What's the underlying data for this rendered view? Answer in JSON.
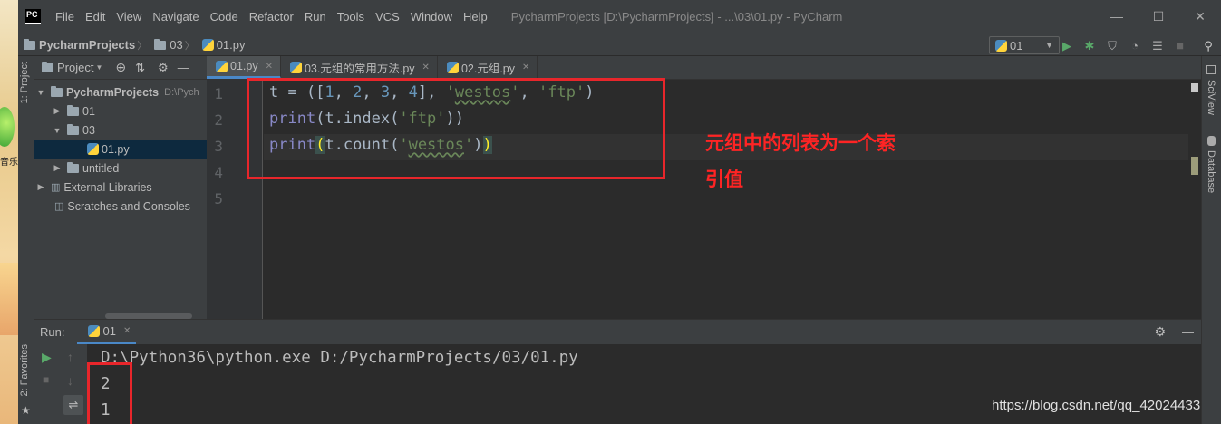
{
  "desktop": {
    "shortcut_label": "音乐"
  },
  "titlebar": {
    "logo": "PC",
    "menu": [
      "File",
      "Edit",
      "View",
      "Navigate",
      "Code",
      "Refactor",
      "Run",
      "Tools",
      "VCS",
      "Window",
      "Help"
    ],
    "window_title": "PycharmProjects [D:\\PycharmProjects] - ...\\03\\01.py - PyCharm",
    "buttons": {
      "minimize": "—",
      "maximize": "☐",
      "close": "✕"
    }
  },
  "navbar": {
    "breadcrumbs": [
      "PycharmProjects",
      "03",
      "01.py"
    ],
    "run_config": "01"
  },
  "project_panel": {
    "title": "Project",
    "tree": [
      {
        "label": "PycharmProjects",
        "hint": "D:\\Pych",
        "type": "root"
      },
      {
        "label": "01",
        "type": "folder"
      },
      {
        "label": "03",
        "type": "folder"
      },
      {
        "label": "01.py",
        "type": "file"
      },
      {
        "label": "untitled",
        "type": "folder"
      },
      {
        "label": "External Libraries",
        "type": "lib"
      },
      {
        "label": "Scratches and Consoles",
        "type": "scratch"
      }
    ]
  },
  "side_labels": {
    "left_top": "1: Project",
    "left_bottom": "2: Favorites",
    "right_1": "SciView",
    "right_2": "Database"
  },
  "tabs": [
    {
      "label": "01.py",
      "active": true
    },
    {
      "label": "03.元组的常用方法.py",
      "active": false
    },
    {
      "label": "02.元组.py",
      "active": false
    }
  ],
  "editor": {
    "line_numbers": [
      "1",
      "2",
      "3",
      "4",
      "5"
    ],
    "lines": [
      "t = ([1, 2, 3, 4], 'westos', 'ftp')",
      "print(t.index('ftp'))",
      "print(t.count('westos'))"
    ]
  },
  "annotation": {
    "line1": "元组中的列表为一个索",
    "line2": "引值",
    "color": "#e8262b"
  },
  "run": {
    "label": "Run:",
    "tab": "01",
    "output": [
      "D:\\Python36\\python.exe D:/PycharmProjects/03/01.py",
      "2",
      "1"
    ]
  },
  "watermark": "https://blog.csdn.net/qq_42024433"
}
